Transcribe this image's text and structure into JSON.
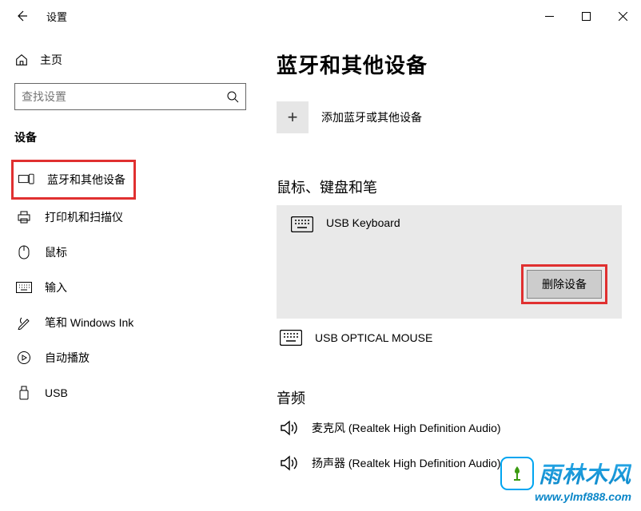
{
  "window": {
    "title": "设置"
  },
  "sidebar": {
    "home_label": "主页",
    "search_placeholder": "查找设置",
    "section_label": "设备",
    "items": [
      {
        "label": "蓝牙和其他设备"
      },
      {
        "label": "打印机和扫描仪"
      },
      {
        "label": "鼠标"
      },
      {
        "label": "输入"
      },
      {
        "label": "笔和 Windows Ink"
      },
      {
        "label": "自动播放"
      },
      {
        "label": "USB"
      }
    ]
  },
  "main": {
    "page_title": "蓝牙和其他设备",
    "add_device_label": "添加蓝牙或其他设备",
    "sections": {
      "mouse_keyboard_pen": {
        "header": "鼠标、键盘和笔",
        "devices": [
          {
            "name": "USB Keyboard",
            "remove_label": "删除设备"
          },
          {
            "name": "USB OPTICAL MOUSE"
          }
        ]
      },
      "audio": {
        "header": "音频",
        "devices": [
          {
            "name": "麦克风 (Realtek High Definition Audio)"
          },
          {
            "name": "扬声器 (Realtek High Definition Audio)"
          }
        ]
      }
    }
  },
  "footer": {
    "brand": "雨林木风",
    "url": "www.ylmf888.com"
  }
}
